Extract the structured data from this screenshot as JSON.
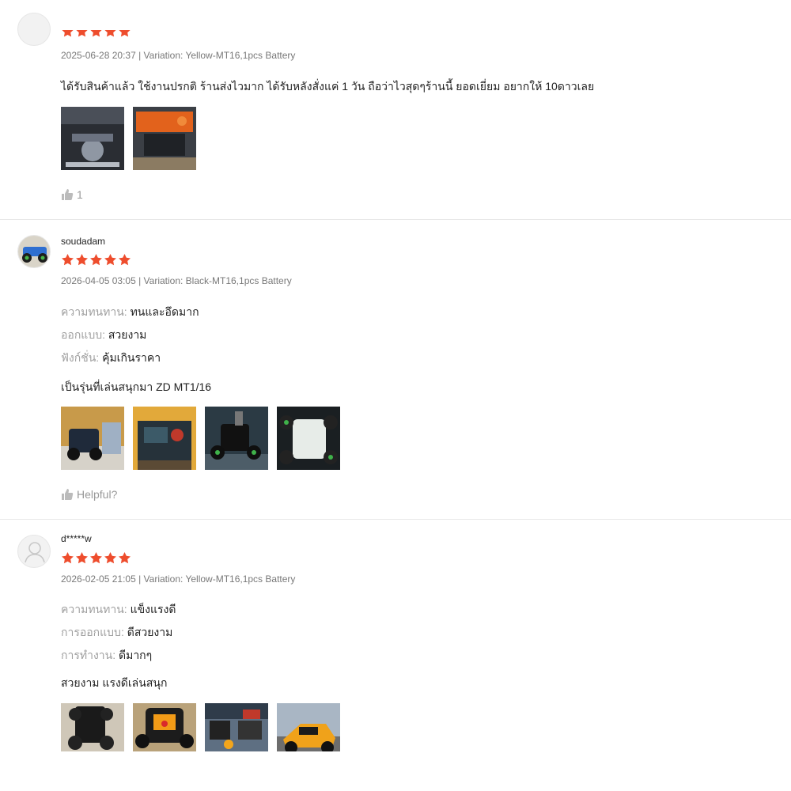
{
  "reviews": [
    {
      "username": "",
      "rating": 5,
      "meta": "2025-06-28 20:37 | Variation: Yellow-MT16,1pcs Battery",
      "attributes": [],
      "content": "ได้รับสินค้าแล้ว ใช้งานปรกติ  ร้านส่งไวมาก ได้รับหลังสั่งแค่ 1 วัน  ถือว่าไวสุดๆร้านนี้ ยอดเยี่ยม อยากให้ 10ดาวเลย",
      "media_count": 2,
      "helpful_label": "1"
    },
    {
      "username": "soudadam",
      "rating": 5,
      "meta": "2026-04-05 03:05 | Variation: Black-MT16,1pcs Battery",
      "attributes": [
        {
          "label": "ความทนทาน:",
          "value": "ทนและอึดมาก"
        },
        {
          "label": "ออกแบบ:",
          "value": "สวยงาม"
        },
        {
          "label": "ฟังก์ชั่น:",
          "value": "คุ้มเกินราคา"
        }
      ],
      "content": "เป็นรุ่นที่เล่นสนุกมา ZD MT1/16",
      "media_count": 4,
      "helpful_label": "Helpful?"
    },
    {
      "username": "d*****w",
      "rating": 5,
      "meta": "2026-02-05 21:05 | Variation: Yellow-MT16,1pcs Battery",
      "attributes": [
        {
          "label": "ความทนทาน:",
          "value": "แข็งแรงดี"
        },
        {
          "label": "การออกแบบ:",
          "value": "ดีสวยงาม"
        },
        {
          "label": "การทำงาน:",
          "value": "ดีมากๆ"
        }
      ],
      "content": "สวยงาม แรงดีเล่นสนุก",
      "media_count": 4,
      "helpful_label": ""
    }
  ],
  "icons": {
    "star": "star-icon",
    "like": "thumbs-up-icon",
    "default_avatar": "user-icon"
  },
  "colors": {
    "star": "#ee4d2d",
    "meta_text": "#757575",
    "attr_label": "#a0a0a0",
    "divider": "#e8e8e8"
  }
}
